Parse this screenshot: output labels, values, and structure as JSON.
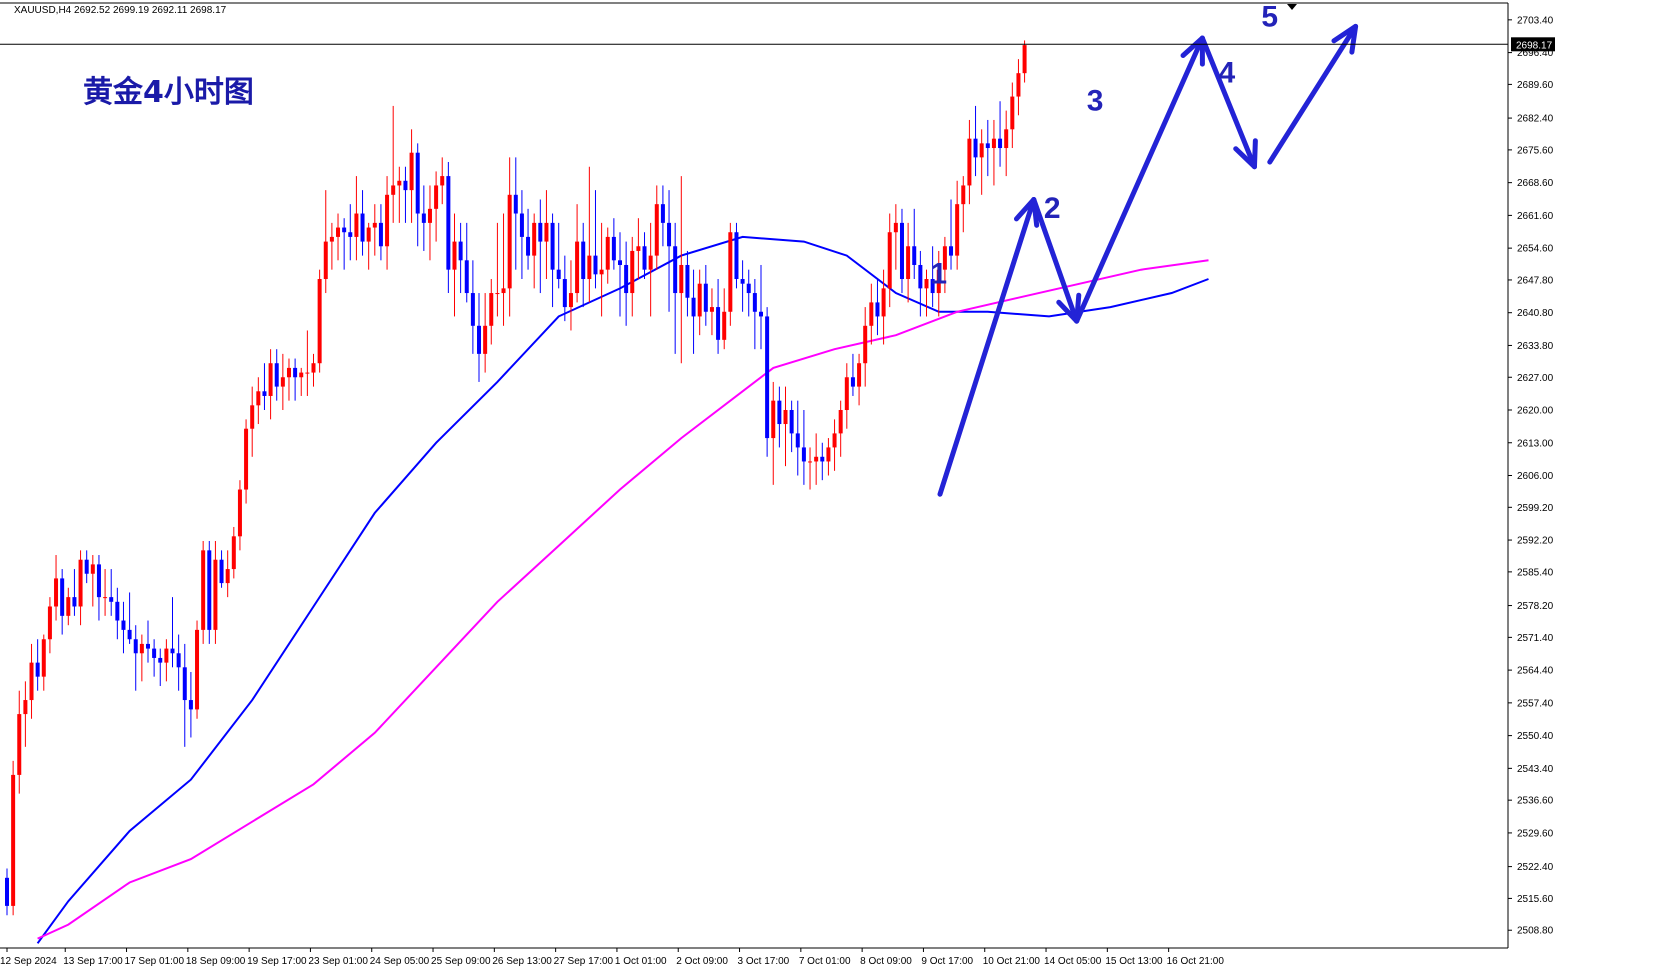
{
  "window": {
    "symbol_info": "XAUUSD,H4  2692.52 2699.19 2692.11 2698.17",
    "title": "黄金4小时图"
  },
  "colors": {
    "bull": "#ff0000",
    "bear": "#0000ff",
    "ma_fast": "#0000ff",
    "ma_slow": "#ff00ff",
    "arrows": "#2323d6",
    "current_price_bg": "#000000"
  },
  "current_price": {
    "value": 2698.17,
    "label": "2698.17"
  },
  "waves": [
    {
      "label": "1",
      "x_index": 152.0,
      "y": 2647
    },
    {
      "label": "2",
      "x_index": 170.5,
      "y": 2661
    },
    {
      "label": "3",
      "x_index": 177.5,
      "y": 2684
    },
    {
      "label": "4",
      "x_index": 199.0,
      "y": 2690
    },
    {
      "label": "5",
      "x_index": 206.0,
      "y": 2702
    }
  ],
  "chart_data": {
    "type": "candlestick",
    "title": "黄金4小时图",
    "ylim": [
      2505.0,
      2707.0
    ],
    "y_ticks": [
      2508.8,
      2515.6,
      2522.4,
      2529.6,
      2536.6,
      2543.4,
      2550.4,
      2557.4,
      2564.4,
      2571.4,
      2578.2,
      2585.4,
      2592.2,
      2599.2,
      2606.0,
      2613.0,
      2620.0,
      2627.0,
      2633.8,
      2640.8,
      2647.8,
      2654.6,
      2661.6,
      2668.6,
      2675.6,
      2682.4,
      2689.6,
      2696.4,
      2703.4
    ],
    "x_labels": [
      {
        "label": "12 Sep 2024",
        "index": 0
      },
      {
        "label": "13 Sep 17:00",
        "index": 9.5
      },
      {
        "label": "17 Sep 01:00",
        "index": 19.5
      },
      {
        "label": "18 Sep 09:00",
        "index": 29.5
      },
      {
        "label": "19 Sep 17:00",
        "index": 39.5
      },
      {
        "label": "23 Sep 01:00",
        "index": 49.5
      },
      {
        "label": "24 Sep 05:00",
        "index": 59.5
      },
      {
        "label": "25 Sep 09:00",
        "index": 69.5
      },
      {
        "label": "26 Sep 13:00",
        "index": 79.5
      },
      {
        "label": "27 Sep 17:00",
        "index": 89.5
      },
      {
        "label": "1 Oct 01:00",
        "index": 99.5
      },
      {
        "label": "2 Oct 09:00",
        "index": 109.5
      },
      {
        "label": "3 Oct 17:00",
        "index": 119.5
      },
      {
        "label": "7 Oct 01:00",
        "index": 129.5
      },
      {
        "label": "8 Oct 09:00",
        "index": 139.5
      },
      {
        "label": "9 Oct 17:00",
        "index": 149.5
      },
      {
        "label": "10 Oct 21:00",
        "index": 159.5
      },
      {
        "label": "14 Oct 05:00",
        "index": 169.5
      },
      {
        "label": "15 Oct 13:00",
        "index": 179.5
      },
      {
        "label": "16 Oct 21:00",
        "index": 189.5
      }
    ],
    "series": [
      {
        "name": "MA fast",
        "color": "#0000ff",
        "points": [
          [
            5,
            2506
          ],
          [
            10,
            2515
          ],
          [
            20,
            2530
          ],
          [
            30,
            2541
          ],
          [
            40,
            2558
          ],
          [
            50,
            2578
          ],
          [
            60,
            2598
          ],
          [
            70,
            2613
          ],
          [
            80,
            2626
          ],
          [
            90,
            2640
          ],
          [
            100,
            2646
          ],
          [
            110,
            2653
          ],
          [
            120,
            2657
          ],
          [
            130,
            2656
          ],
          [
            137,
            2653
          ],
          [
            145,
            2645
          ],
          [
            152,
            2641
          ],
          [
            160,
            2641
          ],
          [
            170,
            2640
          ],
          [
            180,
            2642
          ],
          [
            190,
            2645
          ],
          [
            196,
            2648
          ]
        ]
      },
      {
        "name": "MA slow",
        "color": "#ff00ff",
        "points": [
          [
            5,
            2507
          ],
          [
            10,
            2510
          ],
          [
            20,
            2519
          ],
          [
            30,
            2524
          ],
          [
            40,
            2532
          ],
          [
            50,
            2540
          ],
          [
            60,
            2551
          ],
          [
            70,
            2565
          ],
          [
            80,
            2579
          ],
          [
            90,
            2591
          ],
          [
            100,
            2603
          ],
          [
            110,
            2614
          ],
          [
            120,
            2624
          ],
          [
            125,
            2629
          ],
          [
            135,
            2633
          ],
          [
            145,
            2636
          ],
          [
            155,
            2641
          ],
          [
            165,
            2644
          ],
          [
            175,
            2647
          ],
          [
            185,
            2650
          ],
          [
            196,
            2652
          ]
        ]
      }
    ],
    "candles": [
      [
        2520,
        2522,
        2512,
        2514
      ],
      [
        2514,
        2545,
        2512,
        2542
      ],
      [
        2542,
        2560,
        2538,
        2555
      ],
      [
        2555,
        2562,
        2548,
        2558
      ],
      [
        2558,
        2570,
        2554,
        2566
      ],
      [
        2566,
        2571,
        2560,
        2563
      ],
      [
        2563,
        2572,
        2560,
        2571
      ],
      [
        2571,
        2580,
        2568,
        2578
      ],
      [
        2578,
        2589,
        2575,
        2584
      ],
      [
        2584,
        2586,
        2572,
        2576
      ],
      [
        2576,
        2582,
        2574,
        2580
      ],
      [
        2580,
        2586,
        2576,
        2578
      ],
      [
        2578,
        2590,
        2574,
        2588
      ],
      [
        2588,
        2590,
        2583,
        2585
      ],
      [
        2585,
        2589,
        2578,
        2587
      ],
      [
        2587,
        2589,
        2575,
        2580
      ],
      [
        2580,
        2586,
        2576,
        2580
      ],
      [
        2580,
        2586,
        2576,
        2579
      ],
      [
        2579,
        2582,
        2571,
        2575
      ],
      [
        2575,
        2579,
        2568,
        2573
      ],
      [
        2573,
        2581,
        2570,
        2571
      ],
      [
        2571,
        2574,
        2560,
        2568
      ],
      [
        2568,
        2572,
        2562,
        2570
      ],
      [
        2570,
        2575,
        2566,
        2569
      ],
      [
        2569,
        2571,
        2563,
        2567
      ],
      [
        2567,
        2569,
        2561,
        2566
      ],
      [
        2566,
        2571,
        2562,
        2569
      ],
      [
        2569,
        2580,
        2565,
        2568
      ],
      [
        2568,
        2572,
        2560,
        2565
      ],
      [
        2565,
        2570,
        2548,
        2558
      ],
      [
        2558,
        2564,
        2550,
        2556
      ],
      [
        2556,
        2575,
        2554,
        2573
      ],
      [
        2573,
        2592,
        2570,
        2590
      ],
      [
        2590,
        2592,
        2570,
        2573
      ],
      [
        2573,
        2592,
        2570,
        2588
      ],
      [
        2588,
        2590,
        2582,
        2583
      ],
      [
        2583,
        2590,
        2580,
        2586
      ],
      [
        2586,
        2595,
        2584,
        2593
      ],
      [
        2593,
        2605,
        2590,
        2603
      ],
      [
        2603,
        2618,
        2600,
        2616
      ],
      [
        2616,
        2625,
        2610,
        2621
      ],
      [
        2621,
        2627,
        2617,
        2624
      ],
      [
        2624,
        2630,
        2620,
        2623
      ],
      [
        2623,
        2633,
        2618,
        2630
      ],
      [
        2630,
        2633,
        2622,
        2625
      ],
      [
        2625,
        2632,
        2620,
        2627
      ],
      [
        2627,
        2631,
        2622,
        2629
      ],
      [
        2629,
        2631,
        2622,
        2627
      ],
      [
        2627,
        2629,
        2623,
        2628
      ],
      [
        2628,
        2637,
        2623,
        2628
      ],
      [
        2628,
        2632,
        2625,
        2630
      ],
      [
        2630,
        2650,
        2628,
        2648
      ],
      [
        2648,
        2667,
        2645,
        2656
      ],
      [
        2656,
        2660,
        2650,
        2657
      ],
      [
        2657,
        2662,
        2652,
        2659
      ],
      [
        2659,
        2661,
        2650,
        2658
      ],
      [
        2658,
        2664,
        2652,
        2657
      ],
      [
        2657,
        2670,
        2652,
        2662
      ],
      [
        2662,
        2667,
        2653,
        2656
      ],
      [
        2656,
        2660,
        2650,
        2659
      ],
      [
        2659,
        2664,
        2653,
        2660
      ],
      [
        2660,
        2664,
        2652,
        2655
      ],
      [
        2655,
        2670,
        2650,
        2666
      ],
      [
        2666,
        2685,
        2660,
        2668
      ],
      [
        2668,
        2672,
        2660,
        2669
      ],
      [
        2669,
        2672,
        2660,
        2667
      ],
      [
        2667,
        2680,
        2660,
        2675
      ],
      [
        2675,
        2677,
        2655,
        2662
      ],
      [
        2662,
        2668,
        2654,
        2660
      ],
      [
        2660,
        2668,
        2652,
        2663
      ],
      [
        2663,
        2671,
        2656,
        2668
      ],
      [
        2668,
        2674,
        2664,
        2670
      ],
      [
        2670,
        2673,
        2645,
        2650
      ],
      [
        2650,
        2662,
        2640,
        2656
      ],
      [
        2656,
        2660,
        2645,
        2652
      ],
      [
        2652,
        2660,
        2643,
        2645
      ],
      [
        2645,
        2652,
        2632,
        2638
      ],
      [
        2638,
        2645,
        2626,
        2632
      ],
      [
        2632,
        2645,
        2628,
        2638
      ],
      [
        2638,
        2648,
        2634,
        2645
      ],
      [
        2645,
        2660,
        2640,
        2645
      ],
      [
        2645,
        2662,
        2638,
        2646
      ],
      [
        2646,
        2674,
        2640,
        2666
      ],
      [
        2666,
        2674,
        2650,
        2662
      ],
      [
        2662,
        2667,
        2648,
        2657
      ],
      [
        2657,
        2663,
        2650,
        2653
      ],
      [
        2653,
        2662,
        2646,
        2660
      ],
      [
        2660,
        2665,
        2645,
        2656
      ],
      [
        2656,
        2667,
        2648,
        2660
      ],
      [
        2660,
        2662,
        2642,
        2650
      ],
      [
        2650,
        2660,
        2646,
        2648
      ],
      [
        2648,
        2653,
        2639,
        2642
      ],
      [
        2642,
        2652,
        2637,
        2645
      ],
      [
        2645,
        2664,
        2643,
        2656
      ],
      [
        2656,
        2660,
        2642,
        2648
      ],
      [
        2648,
        2672,
        2643,
        2653
      ],
      [
        2653,
        2667,
        2646,
        2649
      ],
      [
        2649,
        2660,
        2640,
        2650
      ],
      [
        2650,
        2659,
        2647,
        2657
      ],
      [
        2657,
        2661,
        2650,
        2652
      ],
      [
        2652,
        2658,
        2640,
        2651
      ],
      [
        2651,
        2656,
        2638,
        2645
      ],
      [
        2645,
        2657,
        2640,
        2654
      ],
      [
        2654,
        2661,
        2648,
        2655
      ],
      [
        2655,
        2658,
        2648,
        2650
      ],
      [
        2650,
        2660,
        2640,
        2653
      ],
      [
        2653,
        2668,
        2650,
        2664
      ],
      [
        2664,
        2668,
        2655,
        2660
      ],
      [
        2660,
        2667,
        2641,
        2655
      ],
      [
        2655,
        2660,
        2632,
        2645
      ],
      [
        2645,
        2670,
        2630,
        2651
      ],
      [
        2651,
        2654,
        2640,
        2644
      ],
      [
        2644,
        2650,
        2632,
        2640
      ],
      [
        2640,
        2650,
        2636,
        2647
      ],
      [
        2647,
        2651,
        2638,
        2641
      ],
      [
        2641,
        2646,
        2636,
        2642
      ],
      [
        2642,
        2648,
        2632,
        2635
      ],
      [
        2635,
        2646,
        2633,
        2641
      ],
      [
        2641,
        2660,
        2638,
        2658
      ],
      [
        2658,
        2660,
        2646,
        2648
      ],
      [
        2648,
        2652,
        2641,
        2647
      ],
      [
        2647,
        2650,
        2640,
        2645
      ],
      [
        2645,
        2648,
        2633,
        2641
      ],
      [
        2641,
        2651,
        2633,
        2640
      ],
      [
        2640,
        2642,
        2610,
        2614
      ],
      [
        2614,
        2626,
        2604,
        2622
      ],
      [
        2622,
        2625,
        2612,
        2617
      ],
      [
        2617,
        2625,
        2608,
        2620
      ],
      [
        2620,
        2622,
        2611,
        2615
      ],
      [
        2615,
        2622,
        2606,
        2612
      ],
      [
        2612,
        2620,
        2604,
        2609
      ],
      [
        2609,
        2612,
        2603,
        2609
      ],
      [
        2609,
        2615,
        2604,
        2610
      ],
      [
        2610,
        2613,
        2605,
        2609
      ],
      [
        2609,
        2614,
        2606,
        2612
      ],
      [
        2612,
        2618,
        2607,
        2615
      ],
      [
        2615,
        2622,
        2610,
        2620
      ],
      [
        2620,
        2630,
        2616,
        2627
      ],
      [
        2627,
        2632,
        2623,
        2625
      ],
      [
        2625,
        2632,
        2621,
        2630
      ],
      [
        2630,
        2642,
        2625,
        2638
      ],
      [
        2638,
        2647,
        2634,
        2643
      ],
      [
        2643,
        2648,
        2636,
        2640
      ],
      [
        2640,
        2650,
        2634,
        2646
      ],
      [
        2646,
        2662,
        2642,
        2658
      ],
      [
        2658,
        2664,
        2650,
        2660
      ],
      [
        2660,
        2663,
        2645,
        2648
      ],
      [
        2648,
        2660,
        2643,
        2655
      ],
      [
        2655,
        2663,
        2648,
        2651
      ],
      [
        2651,
        2654,
        2640,
        2646
      ],
      [
        2646,
        2650,
        2640,
        2648
      ],
      [
        2648,
        2655,
        2642,
        2645
      ],
      [
        2645,
        2654,
        2640,
        2650
      ],
      [
        2650,
        2657,
        2645,
        2655
      ],
      [
        2655,
        2665,
        2650,
        2653
      ],
      [
        2653,
        2669,
        2650,
        2664
      ],
      [
        2664,
        2670,
        2658,
        2668
      ],
      [
        2668,
        2682,
        2664,
        2678
      ],
      [
        2678,
        2685,
        2670,
        2674
      ],
      [
        2674,
        2680,
        2666,
        2677
      ],
      [
        2677,
        2682,
        2670,
        2676
      ],
      [
        2676,
        2682,
        2668,
        2678
      ],
      [
        2678,
        2686,
        2672,
        2676
      ],
      [
        2676,
        2684,
        2670,
        2680
      ],
      [
        2680,
        2690,
        2676,
        2687
      ],
      [
        2687,
        2695,
        2683,
        2692
      ],
      [
        2692,
        2699,
        2690,
        2698
      ]
    ]
  }
}
